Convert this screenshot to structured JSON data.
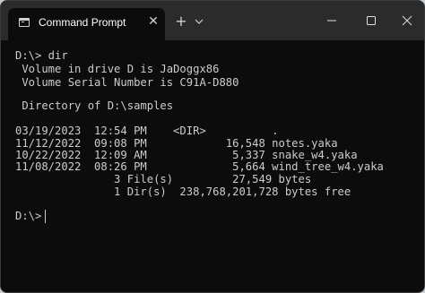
{
  "window": {
    "tab_title": "Command Prompt",
    "tab_icon": "terminal-icon",
    "tab_close_glyph": "✕",
    "new_tab_glyph": "+",
    "controls": [
      "minimize-icon",
      "maximize-icon",
      "close-icon"
    ]
  },
  "terminal": {
    "lines": [
      "D:\\> dir",
      " Volume in drive D is JaDoggx86",
      " Volume Serial Number is C91A-D880",
      "",
      " Directory of D:\\samples",
      "",
      "03/19/2023  12:54 PM    <DIR>          .",
      "11/12/2022  09:08 PM            16,548 notes.yaka",
      "10/22/2022  12:09 AM             5,337 snake_w4.yaka",
      "11/08/2022  08:26 PM             5,664 wind_tree_w4.yaka",
      "               3 File(s)         27,549 bytes",
      "               1 Dir(s)  238,768,201,728 bytes free",
      "",
      "D:\\>"
    ]
  },
  "colors": {
    "background": "#0c0c0c",
    "titlebar": "#2b2b2b",
    "text": "#cccccc"
  }
}
